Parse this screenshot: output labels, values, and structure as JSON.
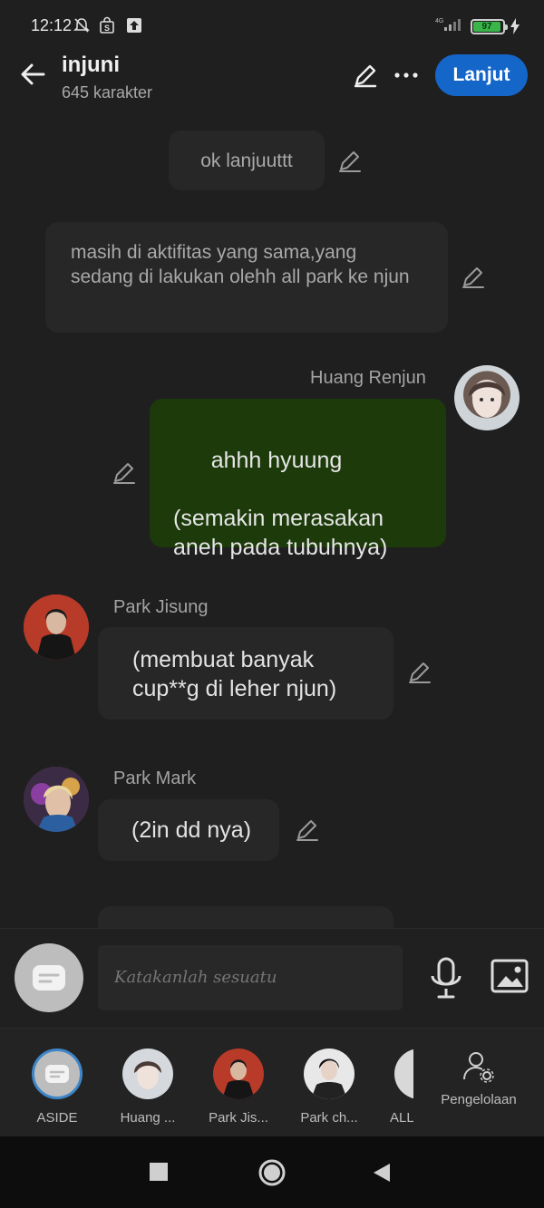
{
  "status_bar": {
    "time": "12:12",
    "network": "4G",
    "battery": "97"
  },
  "header": {
    "title": "injuni",
    "subtitle": "645 karakter",
    "next_button": "Lanjut"
  },
  "messages": [
    {
      "type": "narration",
      "text": "ok lanjuuttt"
    },
    {
      "type": "narration",
      "text": "masih di aktifitas yang sama,yang sedang di lakukan olehh all park ke njun"
    },
    {
      "type": "user",
      "sender": "Huang Renjun",
      "text": "ahhh hyuung\n\n(semakin merasakan aneh pada tubuhnya)"
    },
    {
      "type": "character",
      "sender": "Park Jisung",
      "text": "(membuat banyak cup**g di leher njun)"
    },
    {
      "type": "character",
      "sender": "Park Mark",
      "text": "(2in dd nya)"
    }
  ],
  "composer": {
    "placeholder": "Katakanlah sesuatu"
  },
  "characters": [
    {
      "label": "ASIDE"
    },
    {
      "label": "Huang ..."
    },
    {
      "label": "Park Jis..."
    },
    {
      "label": "Park ch..."
    },
    {
      "label": "ALL"
    }
  ],
  "manage": {
    "label": "Pengelolaan"
  },
  "colors": {
    "background": "#1f1f1f",
    "bubble": "#272727",
    "user_bubble": "#1c3a0a",
    "accent": "#1566c9"
  }
}
